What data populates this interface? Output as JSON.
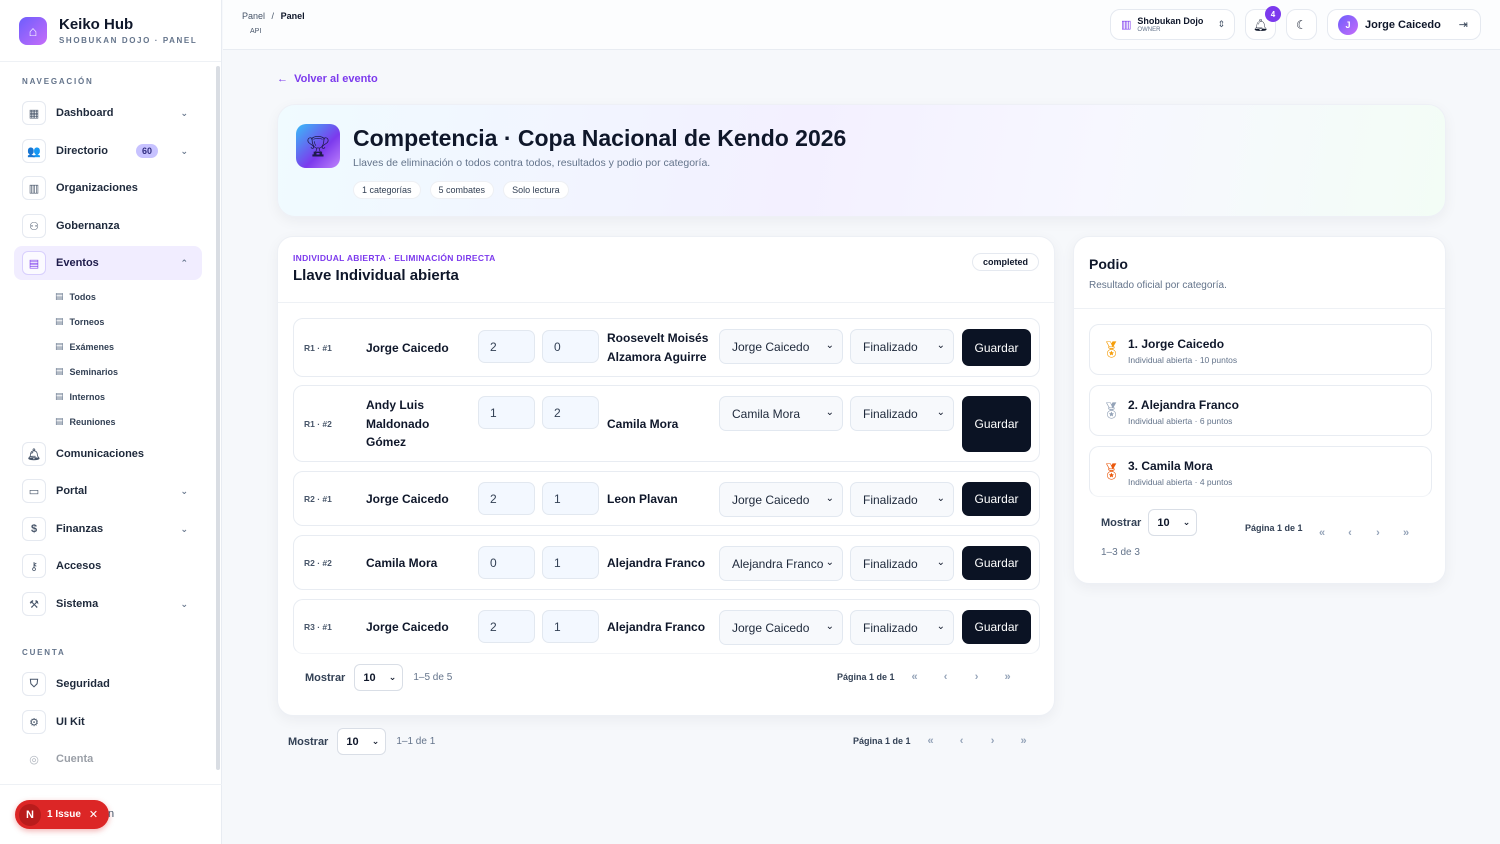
{
  "brand": {
    "title": "Keiko Hub",
    "subtitle": "SHOBUKAN DOJO · PANEL",
    "logo_icon": "app-logo-icon"
  },
  "sidebar": {
    "section_nav": "NAVEGACIÓN",
    "section_account": "CUENTA",
    "items": [
      {
        "label": "Dashboard",
        "icon": "grid-icon"
      },
      {
        "label": "Directorio",
        "icon": "users-icon",
        "badge": "60"
      },
      {
        "label": "Organizaciones",
        "icon": "building-icon"
      },
      {
        "label": "Gobernanza",
        "icon": "network-icon"
      },
      {
        "label": "Eventos",
        "icon": "calendar-icon"
      },
      {
        "label": "Comunicaciones",
        "icon": "bell-icon"
      },
      {
        "label": "Portal",
        "icon": "id-card-icon"
      },
      {
        "label": "Finanzas",
        "icon": "dollar-icon"
      },
      {
        "label": "Accesos",
        "icon": "key-icon"
      },
      {
        "label": "Sistema",
        "icon": "wrench-icon"
      }
    ],
    "event_subitems": [
      "Todos",
      "Torneos",
      "Exámenes",
      "Seminarios",
      "Internos",
      "Reuniones"
    ],
    "account_items": [
      {
        "label": "Seguridad",
        "icon": "shield-icon"
      },
      {
        "label": "UI Kit",
        "icon": "settings-icon"
      },
      {
        "label": "Cuenta",
        "icon": "user-circle-icon"
      }
    ]
  },
  "issue": {
    "letter": "N",
    "label": "1 Issue",
    "trail": "n"
  },
  "topbar": {
    "breadcrumb": {
      "first": "Panel",
      "sep": "/",
      "current": "Panel"
    },
    "api_tag": "API",
    "org": {
      "name": "Shobukan Dojo",
      "role": "OWNER"
    },
    "notifications": "4",
    "user": {
      "initial": "J",
      "name": "Jorge Caicedo"
    }
  },
  "main": {
    "back_label": "Volver al evento",
    "title": "Competencia · Copa Nacional de Kendo 2026",
    "subtitle": "Llaves de eliminación o todos contra todos, resultados y podio por categoría.",
    "chips": [
      "1 categorías",
      "5 combates",
      "Solo lectura"
    ]
  },
  "bracket": {
    "kicker": "INDIVIDUAL ABIERTA · ELIMINACIÓN DIRECTA",
    "title": "Llave Individual abierta",
    "status": "completed",
    "save_label": "Guardar",
    "matches": [
      {
        "round": "R1 · #1",
        "p1": "Jorge Caicedo",
        "s1": "2",
        "s2": "0",
        "p2": "Roosevelt Moisés Alzamora Aguirre",
        "winner": "Jorge Caicedo",
        "state": "Finalizado"
      },
      {
        "round": "R1 · #2",
        "p1": "Andy Luis Maldonado Gómez",
        "s1": "1",
        "s2": "2",
        "p2": "Camila Mora",
        "winner": "Camila Mora",
        "state": "Finalizado"
      },
      {
        "round": "R2 · #1",
        "p1": "Jorge Caicedo",
        "s1": "2",
        "s2": "1",
        "p2": "Leon Plavan",
        "winner": "Jorge Caicedo",
        "state": "Finalizado"
      },
      {
        "round": "R2 · #2",
        "p1": "Camila Mora",
        "s1": "0",
        "s2": "1",
        "p2": "Alejandra Franco",
        "winner": "Alejandra Franco",
        "state": "Finalizado"
      },
      {
        "round": "R3 · #1",
        "p1": "Jorge Caicedo",
        "s1": "2",
        "s2": "1",
        "p2": "Alejandra Franco",
        "winner": "Jorge Caicedo",
        "state": "Finalizado"
      }
    ],
    "pager": {
      "show_label": "Mostrar",
      "size": "10",
      "range": "1–5 de 5",
      "page": "Página 1 de 1"
    }
  },
  "outer_pager": {
    "show_label": "Mostrar",
    "size": "10",
    "range": "1–1 de 1",
    "page": "Página 1 de 1"
  },
  "podium": {
    "title": "Podio",
    "subtitle": "Resultado oficial por categoría.",
    "entries": [
      {
        "name": "1. Jorge Caicedo",
        "meta": "Individual abierta · 10 puntos",
        "color": "#f59e0b"
      },
      {
        "name": "2. Alejandra Franco",
        "meta": "Individual abierta · 6 puntos",
        "color": "#94a3b8"
      },
      {
        "name": "3. Camila Mora",
        "meta": "Individual abierta · 4 puntos",
        "color": "#ea580c"
      }
    ],
    "pager": {
      "show_label": "Mostrar",
      "size": "10",
      "range": "1–3 de 3",
      "page": "Página 1 de 1"
    }
  },
  "pager_arrows": [
    "«",
    "‹",
    "›",
    "»"
  ]
}
